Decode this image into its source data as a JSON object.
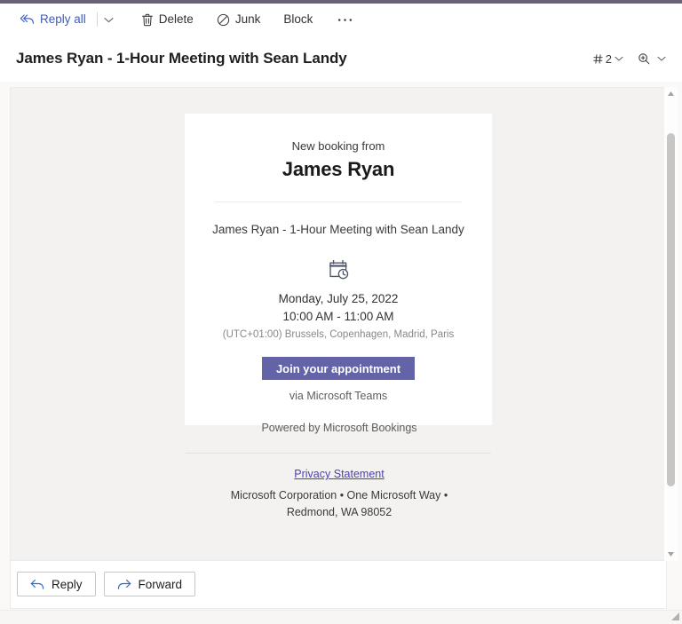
{
  "window": {
    "accent_color": "#6a6378"
  },
  "command_bar": {
    "items": [
      {
        "label": "Reply all",
        "icon": "reply-all-icon"
      },
      {
        "label": "Delete",
        "icon": "trash-icon"
      },
      {
        "label": "Junk",
        "icon": "block-circle-icon"
      },
      {
        "label": "Block",
        "icon": ""
      },
      {
        "label": "⋯",
        "icon": "more-options-icon"
      }
    ],
    "reply_all_label": "Reply all",
    "delete_label": "Delete",
    "junk_label": "Junk",
    "block_label": "Block",
    "more_label": "···"
  },
  "header": {
    "subject": "James Ryan - 1-Hour Meeting with Sean Landy",
    "hash_symbol": "#",
    "message_count": "2",
    "zoom_icon": "magnifier-icon"
  },
  "email_body": {
    "card": {
      "kicker": "New booking from",
      "name": "James Ryan",
      "subject": "James Ryan - 1-Hour Meeting with Sean Landy",
      "calendar_icon": "calendar-clock-icon",
      "date": "Monday, July 25, 2022",
      "time": "10:00 AM - 11:00 AM",
      "timezone": "(UTC+01:00) Brussels, Copenhagen, Madrid, Paris",
      "join_button_label": "Join your appointment",
      "join_button_color": "#6264a7",
      "via_label": "via Microsoft Teams"
    },
    "powered_by": "Powered by Microsoft Bookings",
    "footer": {
      "privacy_link": "Privacy Statement",
      "privacy_link_color": "#4b3fb8",
      "address_line1": "Microsoft Corporation • One Microsoft Way •",
      "address_line2": "Redmond, WA 98052"
    }
  },
  "bottom_actions": {
    "reply_label": "Reply",
    "forward_label": "Forward"
  },
  "scrollbar": {
    "up_glyph": "▲",
    "down_glyph": "▼"
  }
}
